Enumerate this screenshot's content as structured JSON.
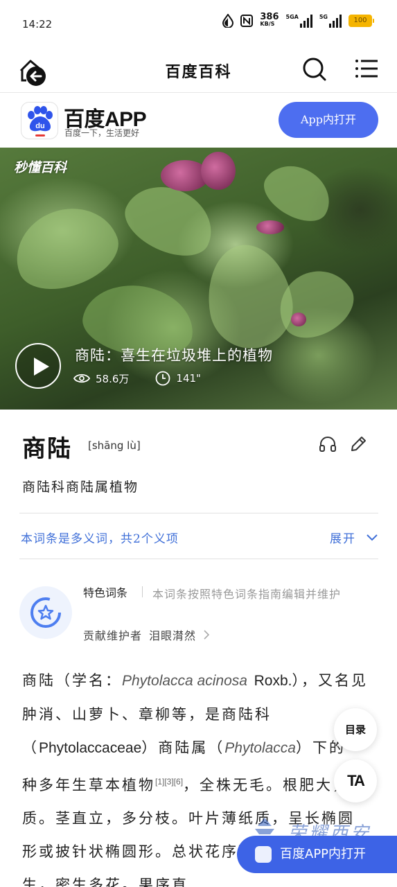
{
  "status_bar": {
    "time": "14:22",
    "net_speed_value": "386",
    "net_speed_unit": "KB/S",
    "sim1_label": "5GA",
    "sim2_label": "5G",
    "battery": "100"
  },
  "nav": {
    "title": "百度百科",
    "back_icon": "back-arrow-icon",
    "search_icon": "search-icon",
    "menu_icon": "menu-icon"
  },
  "app_banner": {
    "app_name": "百度APP",
    "slogan": "百度一下，生活更好",
    "logo_text": "du",
    "open_button": "App内打开"
  },
  "video": {
    "watermark": "秒懂百科",
    "title": "商陆：喜生在垃圾堆上的植物",
    "views": "58.6万",
    "duration": "141\""
  },
  "entry": {
    "term": "商陆",
    "pinyin": "[shāng lù]",
    "subtitle": "商陆科商陆属植物"
  },
  "polysemy": {
    "text": "本词条是多义词，共2个义项",
    "expand": "展开"
  },
  "featured": {
    "tag": "特色词条",
    "description": "本词条按照特色词条指南编辑并维护",
    "contributor_label": "贡献维护者",
    "contributor_name": "泪眼潸然"
  },
  "body": {
    "p1": "商陆（学名：",
    "latin_name": "Phytolacca acinosa",
    "author": "Roxb.",
    "p2": "），又名见肿消、山萝卜、章柳等，是商陆科（",
    "family_latin": "Phytolaccaceae",
    "p3": "）商陆属（",
    "genus_latin": "Phytolacca",
    "p4": "）下的一种多年生草本植物",
    "refs": "[1][3][6]",
    "p5": "，全株无毛。根肥大，肉质。茎直立，多分枝。叶片薄纸质，呈长椭圆形或披针状椭圆形。总状花序顶生或与叶对生，密生多花。果序直"
  },
  "floating": {
    "toc": "目录",
    "ta": "TA",
    "open_in_app": "百度APP内打开"
  },
  "overlay_watermark": "荣耀西安"
}
